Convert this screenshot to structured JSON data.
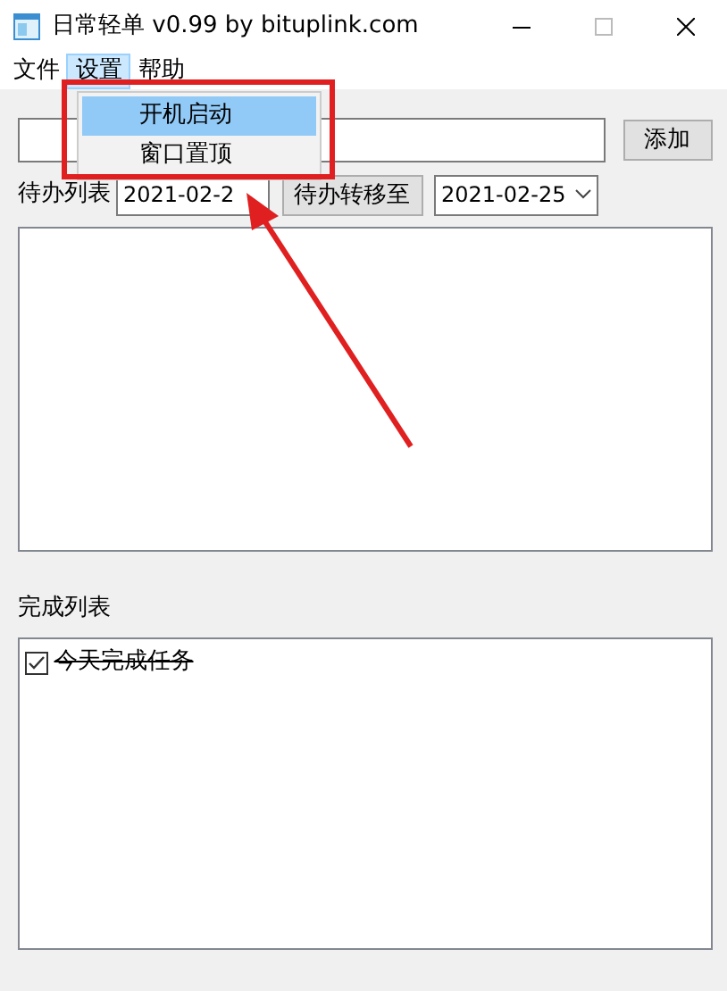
{
  "window": {
    "title": "日常轻单 v0.99 by bituplink.com"
  },
  "menu": [
    {
      "label": "文件",
      "selected": false
    },
    {
      "label": "设置",
      "selected": true
    },
    {
      "label": "帮助",
      "selected": false
    }
  ],
  "dropdown": [
    {
      "label": "开机启动",
      "selected": true
    },
    {
      "label": "窗口置顶",
      "selected": false
    }
  ],
  "add_button": "添加",
  "todo_label": "待办列表",
  "date_from": "2021-02-2",
  "move_button": "待办转移至",
  "date_to": "2021-02-25",
  "done_label": "完成列表",
  "done_items": [
    {
      "text": "今天完成任务",
      "checked": true
    }
  ],
  "annotation": {
    "kind": "highlight"
  }
}
